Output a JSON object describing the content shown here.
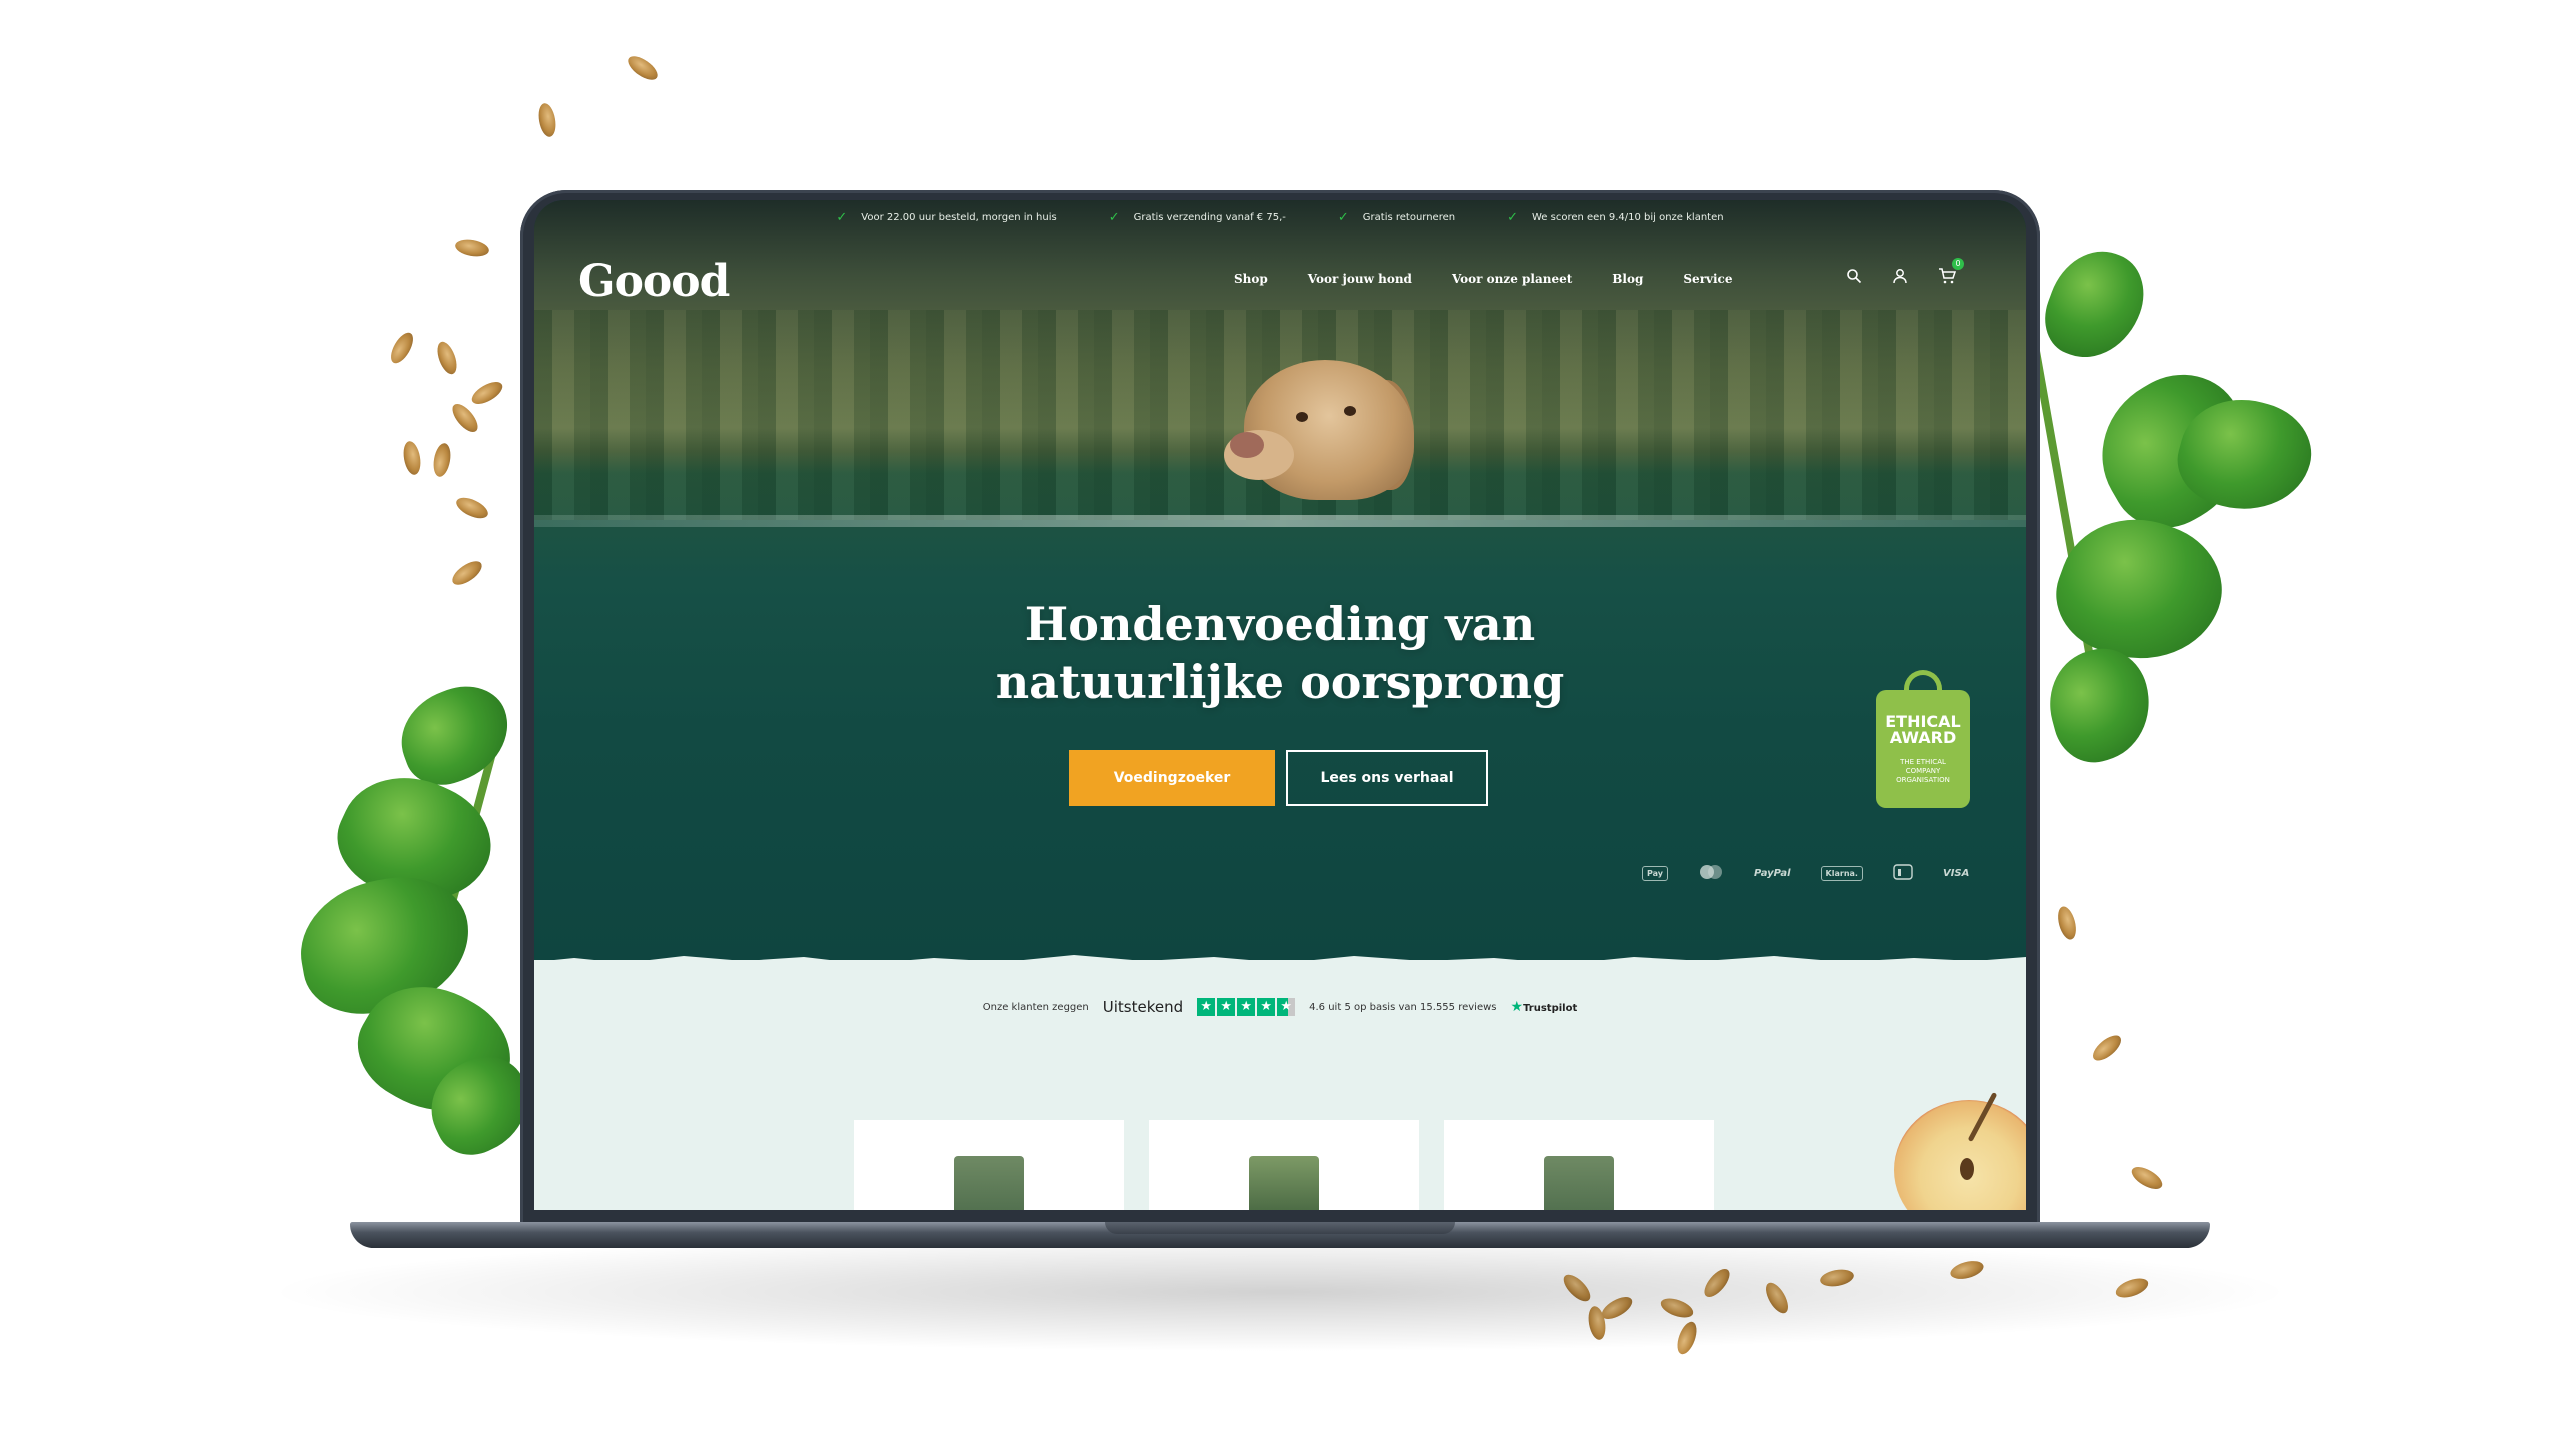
{
  "topbar": {
    "usps": [
      "Voor 22.00 uur besteld, morgen in huis",
      "Gratis verzending vanaf € 75,-",
      "Gratis retourneren",
      "We scoren een 9.4/10 bij onze klanten"
    ]
  },
  "header": {
    "logo": "Goood",
    "menu": [
      "Shop",
      "Voor jouw hond",
      "Voor onze planeet",
      "Blog",
      "Service"
    ],
    "cart_count": "0"
  },
  "hero": {
    "headline_line1": "Hondenvoeding van",
    "headline_line2": "natuurlijke oorsprong",
    "primary_button": "Voedingzoeker",
    "secondary_button": "Lees ons verhaal"
  },
  "award": {
    "title_line1": "ETHICAL",
    "title_line2": "AWARD",
    "sub_line1": "THE ETHICAL",
    "sub_line2": "COMPANY",
    "sub_line3": "ORGANISATION"
  },
  "payments": [
    "Pay",
    "PayPal",
    "Klarna.",
    "VISA"
  ],
  "trustpilot": {
    "intro": "Onze klanten zeggen",
    "rating_word": "Uitstekend",
    "score_text": "4.6 uit 5 op basis van 15.555 reviews",
    "brand": "Trustpilot",
    "stars": 4.6
  },
  "colors": {
    "accent_orange": "#f1a322",
    "trust_green": "#00b67a",
    "award_green": "#8fc04a"
  }
}
